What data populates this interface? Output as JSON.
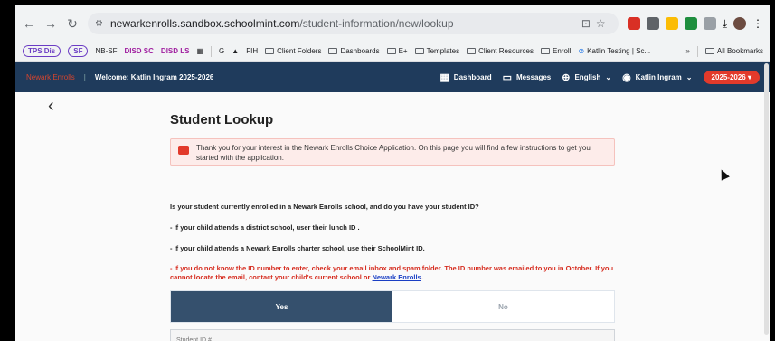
{
  "browser": {
    "back_icon": "arrow-left-icon",
    "forward_icon": "arrow-right-icon",
    "reload_icon": "reload-icon",
    "url_host": "newarkenrolls.sandbox.schoolmint.com",
    "url_path": "/student-information/new/lookup"
  },
  "bookmarks": {
    "items": [
      "TPS Dis",
      "SF",
      "NB-SF",
      "DISD SC",
      "DISD LS",
      "G",
      "FIH",
      "Client Folders",
      "Dashboards",
      "E+",
      "Templates",
      "Client Resources",
      "Enroll",
      "Katlin Testing | Sc...",
      "»",
      "All Bookmarks"
    ]
  },
  "header": {
    "brand": "Newark Enrolls",
    "welcome": "Welcome: Katlin Ingram 2025-2026",
    "dashboard": "Dashboard",
    "messages": "Messages",
    "language": "English",
    "user": "Katlin Ingram",
    "year": "2025-2026 ▾"
  },
  "page": {
    "back": "‹",
    "title": "Student Lookup",
    "alert": "Thank you for your interest in the Newark Enrolls Choice Application. On this page you will find a few instructions to get you started with the application.",
    "question": "Is your student currently enrolled in a Newark Enrolls school, and do you have your student ID?",
    "line1": "- If your child attends a district school, user their lunch ID .",
    "line2": "- If your child attends a Newark Enrolls charter school, use their SchoolMint ID.",
    "red_text": "- If you do not know the ID number to enter, check your email inbox and spam folder. The ID number was emailed to you in October. If you cannot locate the email, contact your child's current school or",
    "red_link": "Newark Enrolls",
    "yes": "Yes",
    "no": "No",
    "field_label": "Student ID #"
  }
}
